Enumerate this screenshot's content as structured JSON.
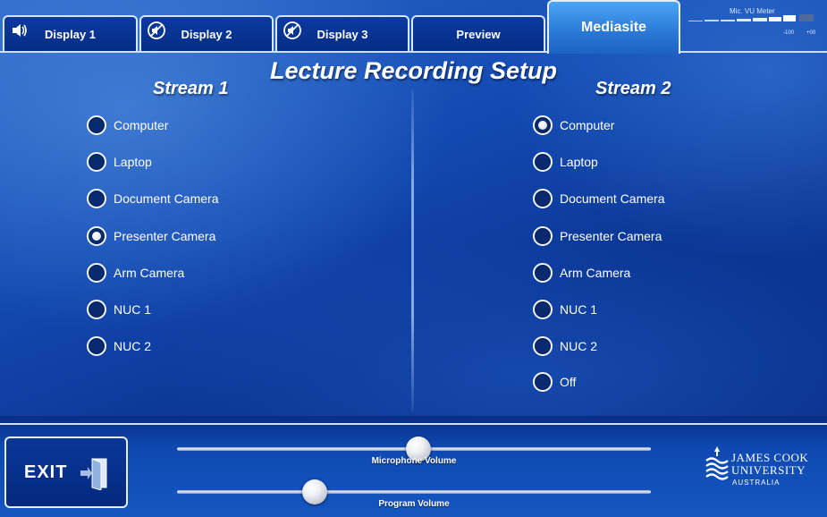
{
  "tabs": [
    {
      "label": "Display 1",
      "icon": "speaker-icon"
    },
    {
      "label": "Display 2",
      "icon": "muted-speaker-icon"
    },
    {
      "label": "Display 3",
      "icon": "muted-speaker-icon"
    },
    {
      "label": "Preview"
    },
    {
      "label": "Mediasite",
      "active": true
    }
  ],
  "vu_meter": {
    "label": "Mic. VU Meter",
    "scale_low": "-100",
    "scale_high": "+00",
    "level": 0.85
  },
  "page_title": "Lecture Recording Setup",
  "stream1": {
    "title": "Stream 1",
    "options": [
      "Computer",
      "Laptop",
      "Document Camera",
      "Presenter Camera",
      "Arm Camera",
      "NUC 1",
      "NUC 2"
    ],
    "selected": "Presenter Camera"
  },
  "stream2": {
    "title": "Stream 2",
    "options": [
      "Computer",
      "Laptop",
      "Document Camera",
      "Presenter Camera",
      "Arm Camera",
      "NUC 1",
      "NUC 2",
      "Off"
    ],
    "selected": "Computer"
  },
  "exit_label": "EXIT",
  "sliders": {
    "microphone": {
      "label": "Microphone Volume",
      "value": 0.51
    },
    "program": {
      "label": "Program Volume",
      "value": 0.29
    }
  },
  "logo": {
    "line1": "JAMES COOK",
    "line2": "UNIVERSITY",
    "line3": "AUSTRALIA"
  },
  "colors": {
    "accent": "#2a78d6",
    "background": "#134ab2",
    "tab": "#062d86"
  }
}
